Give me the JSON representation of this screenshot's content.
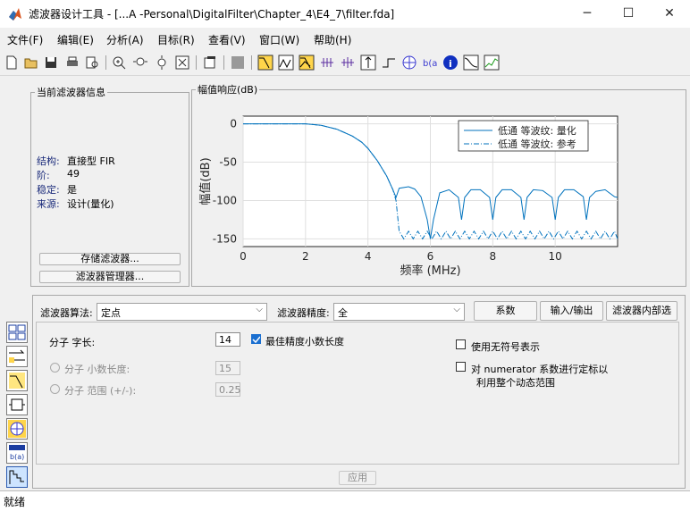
{
  "window": {
    "title": "滤波器设计工具 - [...A -Personal\\DigitalFilter\\Chapter_4\\E4_7\\filter.fda]",
    "minimize": "─",
    "maximize": "☐",
    "close": "✕"
  },
  "menu": [
    "文件(F)",
    "编辑(E)",
    "分析(A)",
    "目标(R)",
    "查看(V)",
    "窗口(W)",
    "帮助(H)"
  ],
  "toolbar_icons": [
    "new-icon",
    "open-icon",
    "save-icon",
    "print-icon",
    "print-preview-icon",
    "zoom-in-icon",
    "zoom-x-icon",
    "zoom-y-icon",
    "full-view-icon",
    "new-window-icon",
    "full-screen-icon",
    "magnitude-response-icon",
    "phase-response-icon",
    "magnitude-phase-icon",
    "group-delay-icon",
    "phase-delay-icon",
    "impulse-response-icon",
    "step-response-icon",
    "pole-zero-icon",
    "coefficients-icon",
    "info-icon",
    "noise-psd-icon",
    "round-off-noise-icon"
  ],
  "current_filter": {
    "legend": "当前滤波器信息",
    "rows": [
      {
        "key": "结构:",
        "value": "直接型 FIR"
      },
      {
        "key": "阶:",
        "value": "49"
      },
      {
        "key": "稳定:",
        "value": "是"
      },
      {
        "key": "来源:",
        "value": "设计(量化)"
      }
    ],
    "store_button": "存储滤波器...",
    "manager_button": "滤波器管理器..."
  },
  "chart_data": {
    "type": "line",
    "title": "幅值响应(dB)",
    "xlabel": "频率 (MHz)",
    "ylabel": "幅值(dB)",
    "xlim": [
      0,
      12
    ],
    "ylim": [
      -160,
      10
    ],
    "xticks": [
      0,
      2,
      4,
      6,
      8,
      10
    ],
    "yticks": [
      0,
      -50,
      -100,
      -150
    ],
    "grid": true,
    "legend_position": "top-right",
    "line_color": "#0072bd",
    "series": [
      {
        "name": "低通 等波纹: 量化",
        "style": "solid",
        "x": [
          0,
          1,
          2,
          2.5,
          3,
          3.5,
          3.8,
          4,
          4.3,
          4.6,
          4.8,
          4.9,
          5.0,
          5.3,
          5.5,
          5.7,
          5.9,
          6.0,
          6.1,
          6.3,
          6.6,
          6.9,
          7.0,
          7.1,
          7.3,
          7.6,
          7.9,
          8.0,
          8.1,
          8.3,
          8.6,
          8.9,
          9.0,
          9.1,
          9.3,
          9.6,
          9.9,
          10.0,
          10.1,
          10.3,
          10.6,
          10.9,
          11.0,
          11.1,
          11.3,
          11.6,
          11.9,
          12
        ],
        "y": [
          0,
          0,
          0,
          -2,
          -7,
          -16,
          -24,
          -32,
          -48,
          -68,
          -86,
          -96,
          -84,
          -82,
          -85,
          -95,
          -125,
          -150,
          -125,
          -90,
          -86,
          -96,
          -125,
          -96,
          -86,
          -86,
          -96,
          -125,
          -96,
          -86,
          -86,
          -96,
          -125,
          -96,
          -86,
          -87,
          -96,
          -125,
          -96,
          -86,
          -86,
          -95,
          -125,
          -96,
          -88,
          -86,
          -95,
          -96
        ]
      },
      {
        "name": "低通 等波纹: 参考",
        "style": "dashdot",
        "x": [
          0,
          1,
          2,
          2.5,
          3,
          3.5,
          3.8,
          4,
          4.3,
          4.6,
          4.8,
          4.9,
          5.0,
          5.15,
          5.3,
          5.45,
          5.6,
          5.75,
          5.9,
          6.05,
          6.2,
          6.35,
          6.5,
          6.65,
          6.8,
          6.95,
          7.1,
          7.25,
          7.4,
          7.55,
          7.7,
          7.85,
          8.0,
          8.15,
          8.3,
          8.45,
          8.6,
          8.75,
          8.9,
          9.05,
          9.2,
          9.35,
          9.5,
          9.65,
          9.8,
          9.95,
          10.1,
          10.25,
          10.4,
          10.55,
          10.7,
          10.85,
          11.0,
          11.15,
          11.3,
          11.45,
          11.6,
          11.75,
          11.9,
          12
        ],
        "y": [
          0,
          0,
          0,
          -2,
          -7,
          -16,
          -24,
          -32,
          -48,
          -68,
          -86,
          -100,
          -140,
          -150,
          -140,
          -150,
          -140,
          -150,
          -140,
          -150,
          -140,
          -150,
          -140,
          -150,
          -140,
          -150,
          -140,
          -150,
          -140,
          -150,
          -140,
          -150,
          -140,
          -150,
          -140,
          -150,
          -140,
          -150,
          -140,
          -150,
          -140,
          -150,
          -140,
          -150,
          -140,
          -150,
          -140,
          -150,
          -140,
          -150,
          -140,
          -150,
          -140,
          -150,
          -140,
          -150,
          -140,
          -150,
          -140,
          -150
        ]
      }
    ]
  },
  "quant_panel": {
    "algorithm_label": "滤波器算法:",
    "algorithm_value": "定点",
    "precision_label": "滤波器精度:",
    "precision_value": "全",
    "tabs": [
      "系数",
      "输入/输出",
      "滤波器内部选"
    ],
    "numerator_wordlength_label": "分子 字长:",
    "numerator_wordlength_value": "14",
    "best_precision_label": "最佳精度小数长度",
    "frac_length_label": "分子 小数长度:",
    "frac_length_value": "15",
    "range_label": "分子 范围 (+/-):",
    "range_value": "0.25",
    "unsigned_label": "使用无符号表示",
    "scale_label_line1": "对 numerator 系数进行定标以",
    "scale_label_line2": "利用整个动态范围",
    "apply_button": "应用"
  },
  "side_icons": [
    "design-filter-icon",
    "transform-filter-icon",
    "filter-design-mag-icon",
    "realize-model-icon",
    "pole-zero-editor-icon",
    "import-filter-icon",
    "quantize-filter-icon",
    "multirate-icon"
  ],
  "status": "就绪"
}
